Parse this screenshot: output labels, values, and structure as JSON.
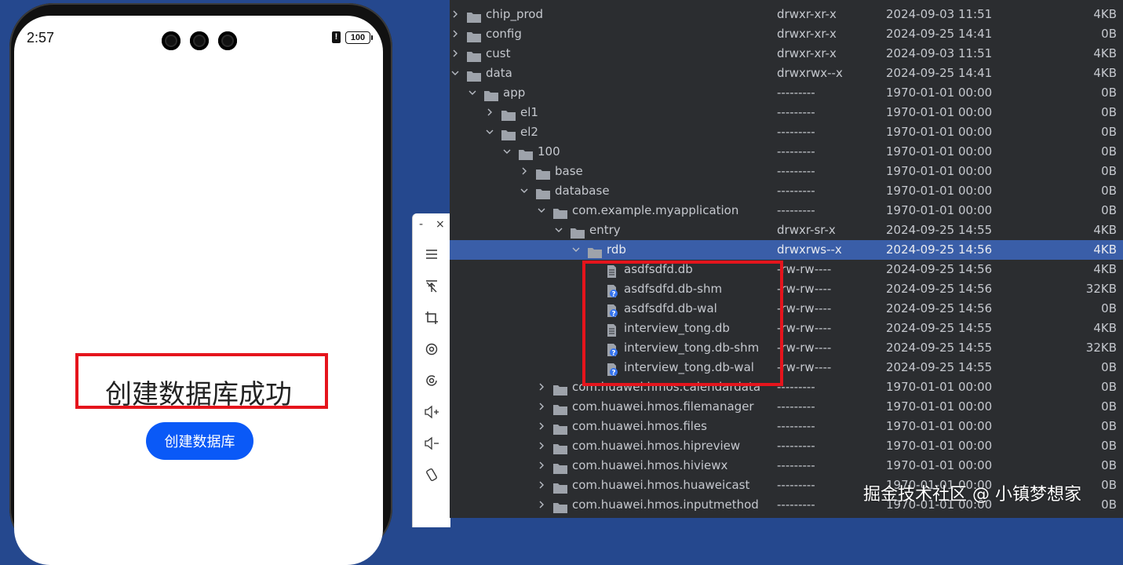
{
  "phone": {
    "status_time": "2:57",
    "alert_icon": "!",
    "battery": "100",
    "result_text": "创建数据库成功",
    "create_button": "创建数据库"
  },
  "toolbar": {
    "minimize": "-",
    "close": "×",
    "items": [
      "menu-icon",
      "pin-top-icon",
      "crop-icon",
      "rotate-icon",
      "screenshot-icon",
      "volume-up-icon",
      "volume-down-icon",
      "rotate-device-icon"
    ]
  },
  "colors": {
    "desktop_bg": "#25488e",
    "panel_bg": "#2b2d30",
    "selected_row": "#3a5ea8",
    "highlight": "#e5141c",
    "button_blue": "#0a59f7"
  },
  "files": [
    {
      "name": "chip_prod",
      "type": "folder",
      "depth": 0,
      "state": "collapsed",
      "perm": "drwxr-xr-x",
      "date": "2024-09-03 11:51",
      "size": "4KB"
    },
    {
      "name": "config",
      "type": "folder",
      "depth": 0,
      "state": "collapsed",
      "perm": "drwxr-xr-x",
      "date": "2024-09-25 14:41",
      "size": "0B"
    },
    {
      "name": "cust",
      "type": "folder",
      "depth": 0,
      "state": "collapsed",
      "perm": "drwxr-xr-x",
      "date": "2024-09-03 11:51",
      "size": "4KB"
    },
    {
      "name": "data",
      "type": "folder",
      "depth": 0,
      "state": "expanded",
      "perm": "drwxrwx--x",
      "date": "2024-09-25 14:41",
      "size": "4KB"
    },
    {
      "name": "app",
      "type": "folder",
      "depth": 1,
      "state": "expanded",
      "perm": "---------",
      "date": "1970-01-01 00:00",
      "size": "0B"
    },
    {
      "name": "el1",
      "type": "folder",
      "depth": 2,
      "state": "collapsed",
      "perm": "---------",
      "date": "1970-01-01 00:00",
      "size": "0B"
    },
    {
      "name": "el2",
      "type": "folder",
      "depth": 2,
      "state": "expanded",
      "perm": "---------",
      "date": "1970-01-01 00:00",
      "size": "0B"
    },
    {
      "name": "100",
      "type": "folder",
      "depth": 3,
      "state": "expanded",
      "perm": "---------",
      "date": "1970-01-01 00:00",
      "size": "0B"
    },
    {
      "name": "base",
      "type": "folder",
      "depth": 4,
      "state": "collapsed",
      "perm": "---------",
      "date": "1970-01-01 00:00",
      "size": "0B"
    },
    {
      "name": "database",
      "type": "folder",
      "depth": 4,
      "state": "expanded",
      "perm": "---------",
      "date": "1970-01-01 00:00",
      "size": "0B"
    },
    {
      "name": "com.example.myapplication",
      "type": "folder",
      "depth": 5,
      "state": "expanded",
      "perm": "---------",
      "date": "1970-01-01 00:00",
      "size": "0B"
    },
    {
      "name": "entry",
      "type": "folder",
      "depth": 6,
      "state": "expanded",
      "perm": "drwxr-sr-x",
      "date": "2024-09-25 14:55",
      "size": "4KB"
    },
    {
      "name": "rdb",
      "type": "folder",
      "depth": 7,
      "state": "expanded",
      "perm": "drwxrws--x",
      "date": "2024-09-25 14:56",
      "size": "4KB",
      "selected": true
    },
    {
      "name": "asdfsdfd.db",
      "type": "file",
      "depth": 8,
      "perm": "-rw-rw----",
      "date": "2024-09-25 14:56",
      "size": "4KB"
    },
    {
      "name": "asdfsdfd.db-shm",
      "type": "unknown",
      "depth": 8,
      "perm": "-rw-rw----",
      "date": "2024-09-25 14:56",
      "size": "32KB"
    },
    {
      "name": "asdfsdfd.db-wal",
      "type": "unknown",
      "depth": 8,
      "perm": "-rw-rw----",
      "date": "2024-09-25 14:56",
      "size": "0B"
    },
    {
      "name": "interview_tong.db",
      "type": "file",
      "depth": 8,
      "perm": "-rw-rw----",
      "date": "2024-09-25 14:55",
      "size": "4KB"
    },
    {
      "name": "interview_tong.db-shm",
      "type": "unknown",
      "depth": 8,
      "perm": "-rw-rw----",
      "date": "2024-09-25 14:55",
      "size": "32KB"
    },
    {
      "name": "interview_tong.db-wal",
      "type": "unknown",
      "depth": 8,
      "perm": "-rw-rw----",
      "date": "2024-09-25 14:55",
      "size": "0B"
    },
    {
      "name": "com.huawei.hmos.calendardata",
      "type": "folder",
      "depth": 5,
      "state": "collapsed",
      "perm": "---------",
      "date": "1970-01-01 00:00",
      "size": "0B"
    },
    {
      "name": "com.huawei.hmos.filemanager",
      "type": "folder",
      "depth": 5,
      "state": "collapsed",
      "perm": "---------",
      "date": "1970-01-01 00:00",
      "size": "0B"
    },
    {
      "name": "com.huawei.hmos.files",
      "type": "folder",
      "depth": 5,
      "state": "collapsed",
      "perm": "---------",
      "date": "1970-01-01 00:00",
      "size": "0B"
    },
    {
      "name": "com.huawei.hmos.hipreview",
      "type": "folder",
      "depth": 5,
      "state": "collapsed",
      "perm": "---------",
      "date": "1970-01-01 00:00",
      "size": "0B"
    },
    {
      "name": "com.huawei.hmos.hiviewx",
      "type": "folder",
      "depth": 5,
      "state": "collapsed",
      "perm": "---------",
      "date": "1970-01-01 00:00",
      "size": "0B"
    },
    {
      "name": "com.huawei.hmos.huaweicast",
      "type": "folder",
      "depth": 5,
      "state": "collapsed",
      "perm": "---------",
      "date": "1970-01-01 00:00",
      "size": "0B"
    },
    {
      "name": "com.huawei.hmos.inputmethod",
      "type": "folder",
      "depth": 5,
      "state": "collapsed",
      "perm": "---------",
      "date": "1970-01-01 00:00",
      "size": "0B"
    }
  ],
  "watermark": "掘金技术社区 @ 小镇梦想家"
}
